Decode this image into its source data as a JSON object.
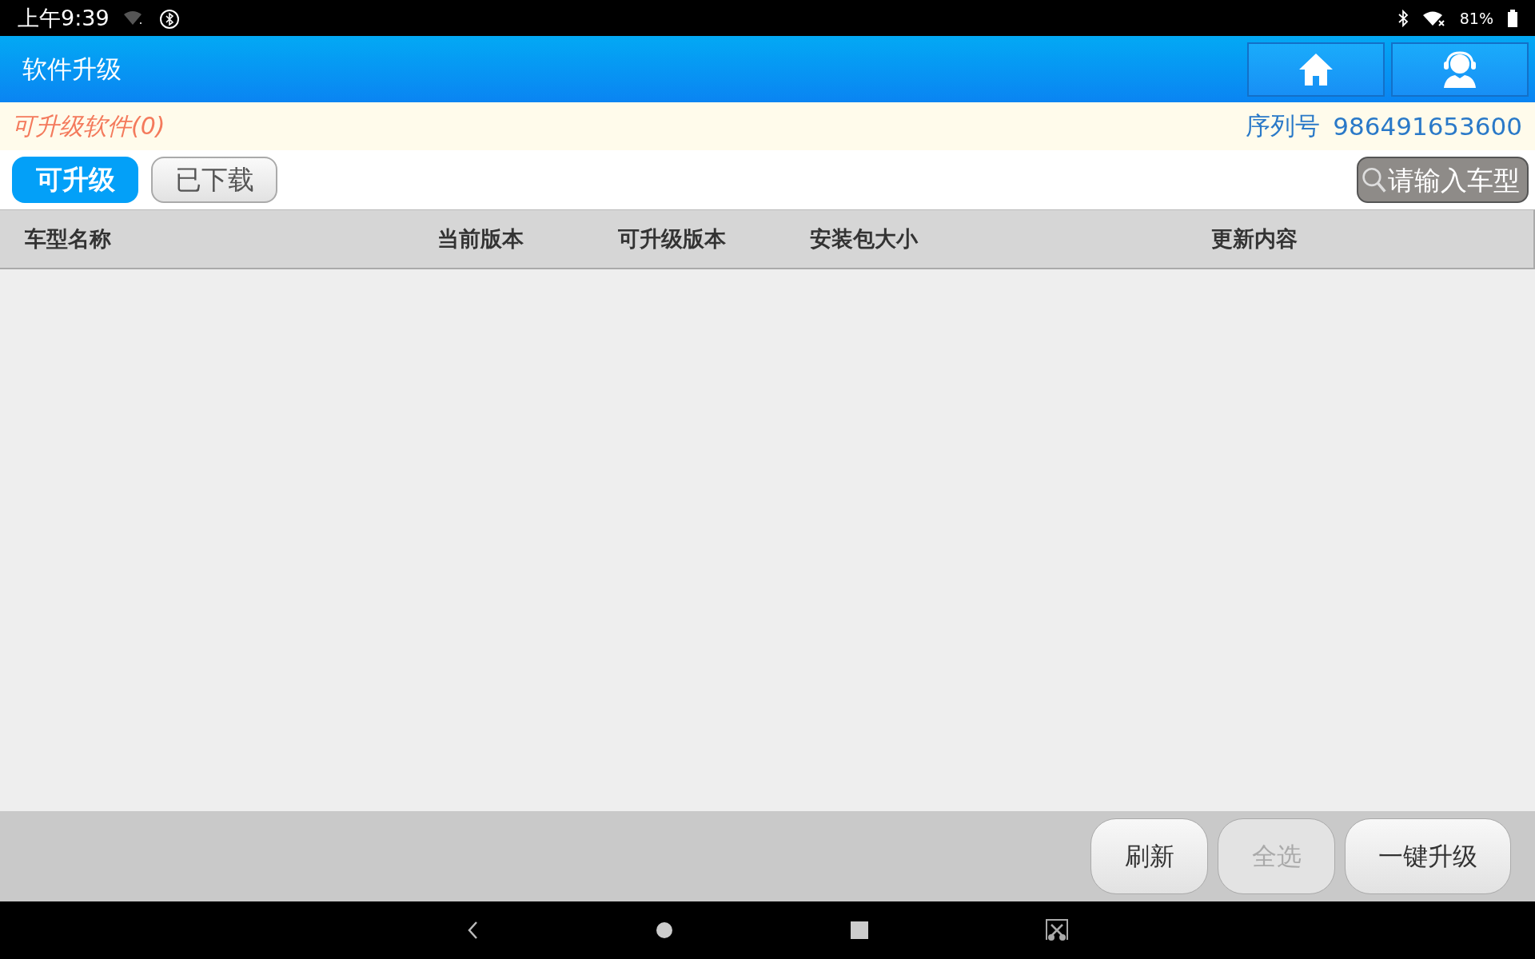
{
  "status_bar": {
    "time": "上午9:39",
    "battery": "81%"
  },
  "header": {
    "title": "软件升级"
  },
  "info_bar": {
    "upgradable_count": "可升级软件(0)",
    "serial_label": "序列号",
    "serial_number": "986491653600"
  },
  "tabs": [
    {
      "label": "可升级",
      "selected": true
    },
    {
      "label": "已下载",
      "selected": false
    }
  ],
  "search": {
    "placeholder": "请输入车型"
  },
  "table": {
    "columns": [
      "车型名称",
      "当前版本",
      "可升级版本",
      "安装包大小",
      "更新内容"
    ]
  },
  "buttons": [
    {
      "label": "刷新",
      "disabled": false
    },
    {
      "label": "全选",
      "disabled": true
    },
    {
      "label": "一键升级",
      "disabled": false
    }
  ]
}
